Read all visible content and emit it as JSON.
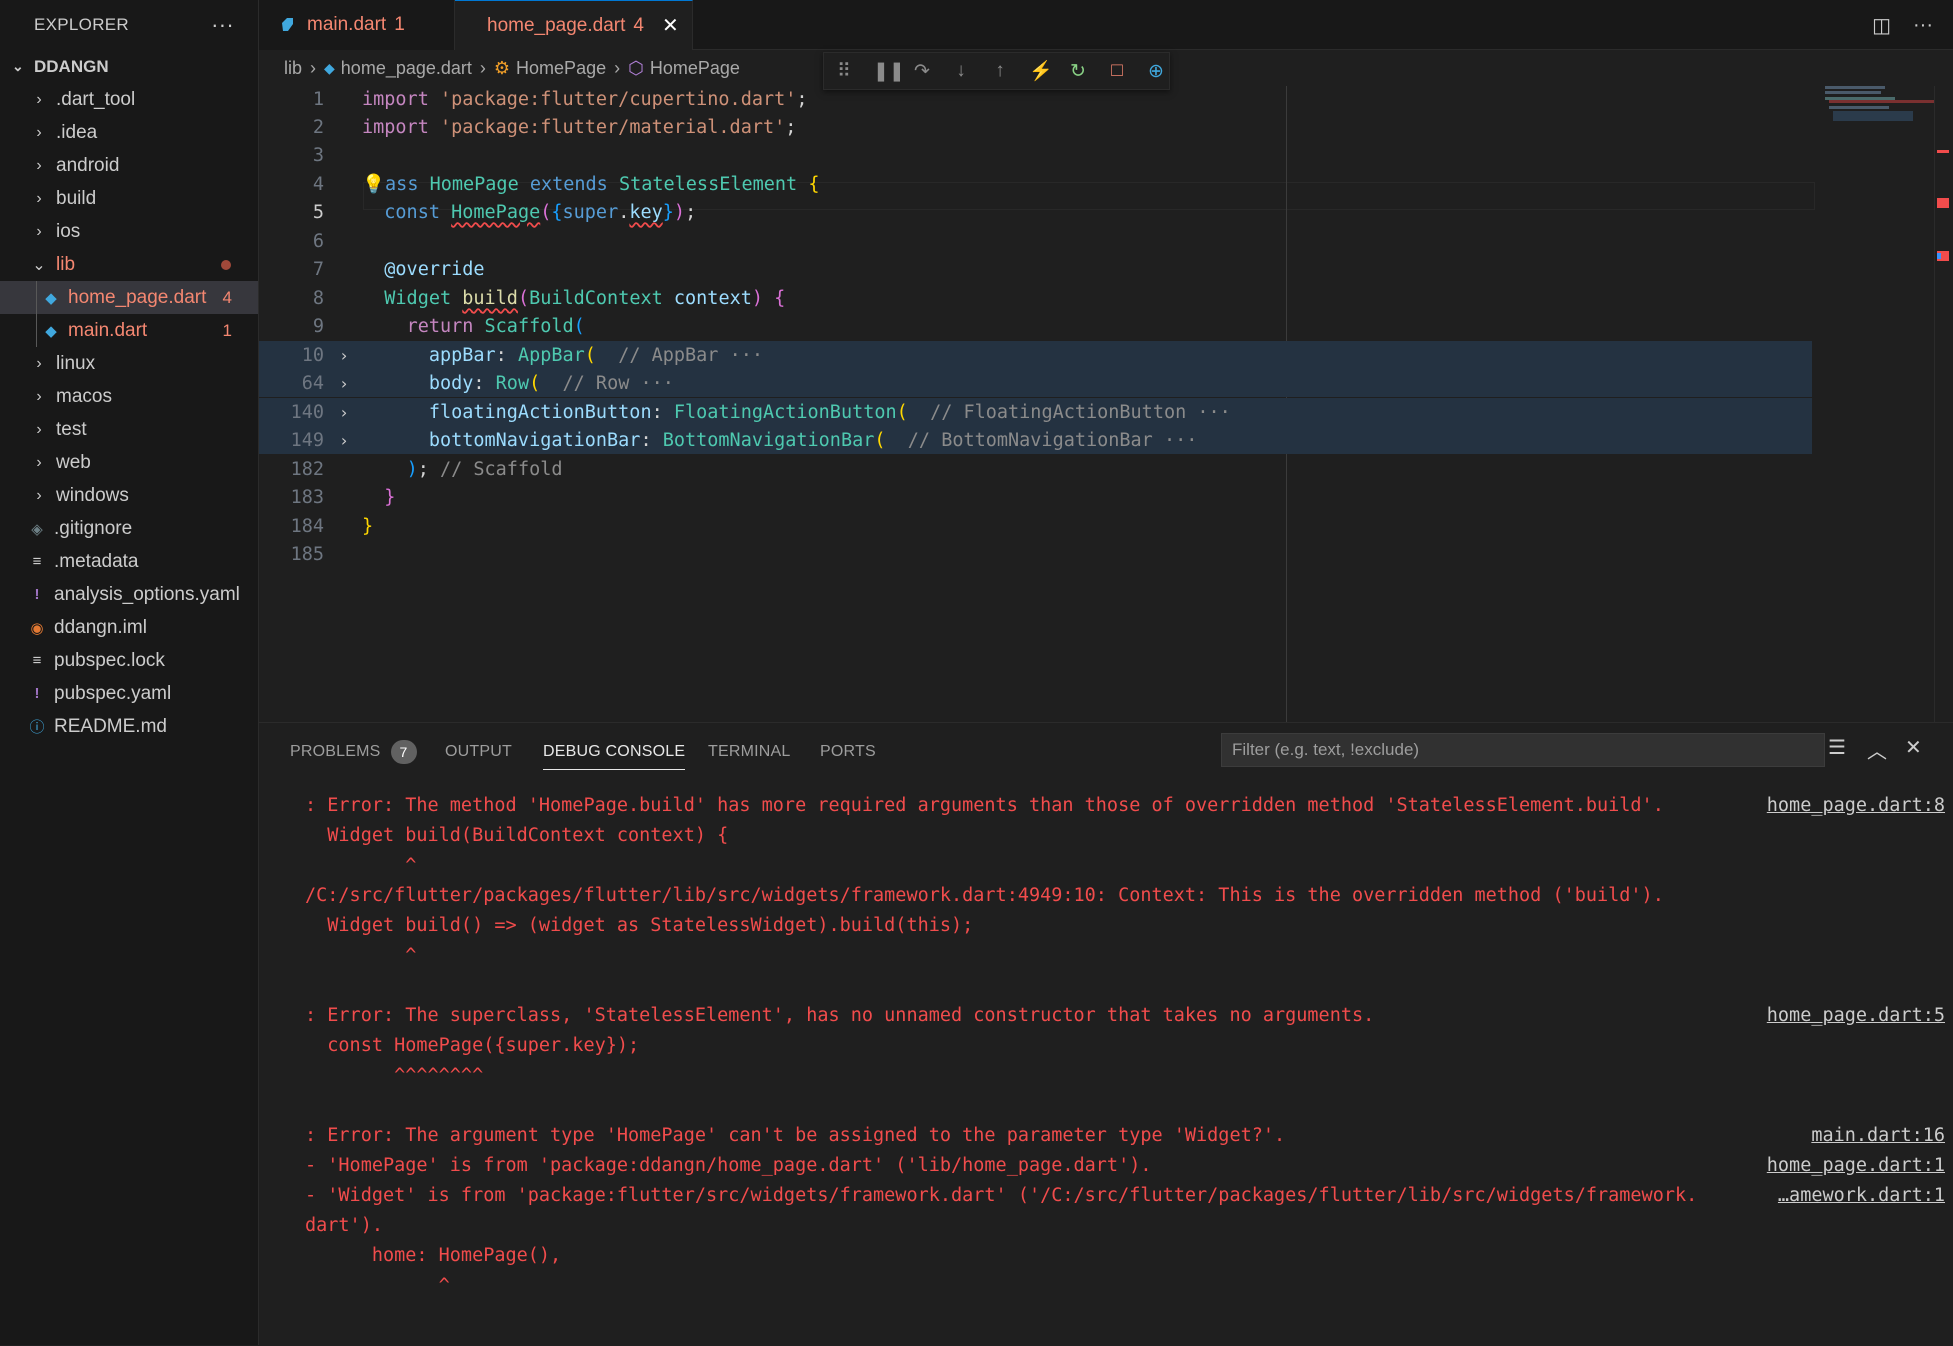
{
  "explorer": {
    "title": "EXPLORER",
    "more": "···",
    "root": "DDANGN",
    "items": [
      {
        "label": ".dart_tool",
        "kind": "folder"
      },
      {
        "label": ".idea",
        "kind": "folder"
      },
      {
        "label": "android",
        "kind": "folder"
      },
      {
        "label": "build",
        "kind": "folder"
      },
      {
        "label": "ios",
        "kind": "folder"
      },
      {
        "label": "lib",
        "kind": "folder-open"
      },
      {
        "label": "home_page.dart",
        "kind": "dart",
        "badge": "4"
      },
      {
        "label": "main.dart",
        "kind": "dart",
        "badge": "1"
      },
      {
        "label": "linux",
        "kind": "folder"
      },
      {
        "label": "macos",
        "kind": "folder"
      },
      {
        "label": "test",
        "kind": "folder"
      },
      {
        "label": "web",
        "kind": "folder"
      },
      {
        "label": "windows",
        "kind": "folder"
      },
      {
        "label": ".gitignore",
        "kind": "git"
      },
      {
        "label": ".metadata",
        "kind": "lines"
      },
      {
        "label": "analysis_options.yaml",
        "kind": "yaml"
      },
      {
        "label": "ddangn.iml",
        "kind": "rss"
      },
      {
        "label": "pubspec.lock",
        "kind": "lines"
      },
      {
        "label": "pubspec.yaml",
        "kind": "yaml"
      },
      {
        "label": "README.md",
        "kind": "info"
      }
    ]
  },
  "tabs": [
    {
      "label": "main.dart",
      "badge": "1",
      "active": false
    },
    {
      "label": "home_page.dart",
      "badge": "4",
      "active": true
    }
  ],
  "breadcrumb": {
    "parts": [
      "lib",
      "home_page.dart",
      "HomePage",
      "HomePage"
    ]
  },
  "editor": {
    "line_numbers": [
      "1",
      "2",
      "3",
      "4",
      "5",
      "6",
      "7",
      "8",
      "9",
      "10",
      "64",
      "140",
      "149",
      "182",
      "183",
      "184",
      "185"
    ],
    "lines": [
      "import 'package:flutter/cupertino.dart';",
      "import 'package:flutter/material.dart';",
      "",
      "class HomePage extends StatelessElement {",
      "  const HomePage({super.key});",
      "",
      "  @override",
      "  Widget build(BuildContext context) {",
      "    return Scaffold(",
      "      appBar: AppBar( // AppBar ···",
      "      body: Row( // Row ···",
      "      floatingActionButton: FloatingActionButton( // FloatingActionButton ···",
      "      bottomNavigationBar: BottomNavigationBar( // BottomNavigationBar ···",
      "    ); // Scaffold",
      "  }",
      "}",
      ""
    ]
  },
  "panel": {
    "tabs": [
      {
        "label": "PROBLEMS",
        "count": "7"
      },
      {
        "label": "OUTPUT"
      },
      {
        "label": "DEBUG CONSOLE",
        "active": true
      },
      {
        "label": "TERMINAL"
      },
      {
        "label": "PORTS"
      }
    ],
    "filter_placeholder": "Filter (e.g. text, !exclude)",
    "console": [
      ": Error: The method 'HomePage.build' has more required arguments than those of overridden method 'StatelessElement.build'.",
      "  Widget build(BuildContext context) {",
      "         ^",
      "/C:/src/flutter/packages/flutter/lib/src/widgets/framework.dart:4949:10: Context: This is the overridden method ('build').",
      "  Widget build() => (widget as StatelessWidget).build(this);",
      "         ^",
      ": Error: The superclass, 'StatelessElement', has no unnamed constructor that takes no arguments.",
      "  const HomePage({super.key});",
      "        ^^^^^^^^",
      ": Error: The argument type 'HomePage' can't be assigned to the parameter type 'Widget?'.",
      "- 'HomePage' is from 'package:ddangn/home_page.dart' ('lib/home_page.dart').",
      "- 'Widget' is from 'package:flutter/src/widgets/framework.dart' ('/C:/src/flutter/packages/flutter/lib/src/widgets/framework.",
      "dart').",
      "      home: HomePage(),",
      "            ^"
    ],
    "sources": [
      "home_page.dart:8",
      "home_page.dart:5",
      "main.dart:16",
      "home_page.dart:1",
      "…amework.dart:1"
    ]
  }
}
